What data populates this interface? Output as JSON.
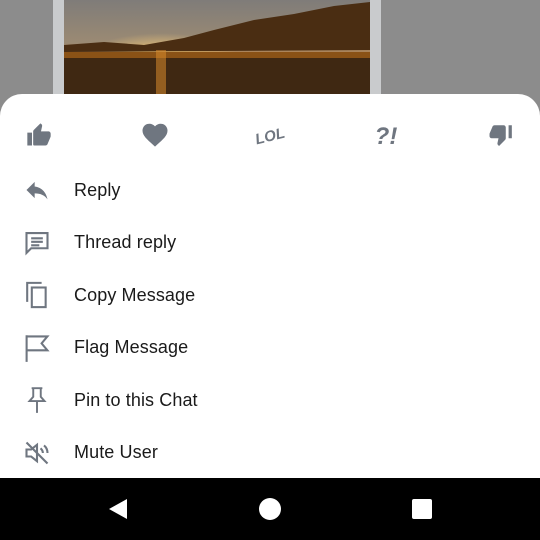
{
  "reactions": [
    {
      "icon": "thumbs-up-icon"
    },
    {
      "icon": "heart-icon"
    },
    {
      "icon": "lol-icon",
      "text": "LOL"
    },
    {
      "icon": "interrobang-icon",
      "text": "?!"
    },
    {
      "icon": "thumbs-down-icon"
    }
  ],
  "menu": {
    "items": [
      {
        "label": "Reply",
        "icon": "reply-icon"
      },
      {
        "label": "Thread reply",
        "icon": "thread-reply-icon"
      },
      {
        "label": "Copy Message",
        "icon": "copy-icon"
      },
      {
        "label": "Flag Message",
        "icon": "flag-icon"
      },
      {
        "label": "Pin to this Chat",
        "icon": "pin-icon"
      },
      {
        "label": "Mute User",
        "icon": "mute-icon"
      }
    ]
  },
  "colors": {
    "icon": "#6f7680",
    "text": "#1a1a1a",
    "overlay": "#8c8c8c",
    "sheet": "#ffffff",
    "navbar": "#000000"
  },
  "navbar": {
    "buttons": [
      "back-icon",
      "home-icon",
      "recents-icon"
    ]
  }
}
